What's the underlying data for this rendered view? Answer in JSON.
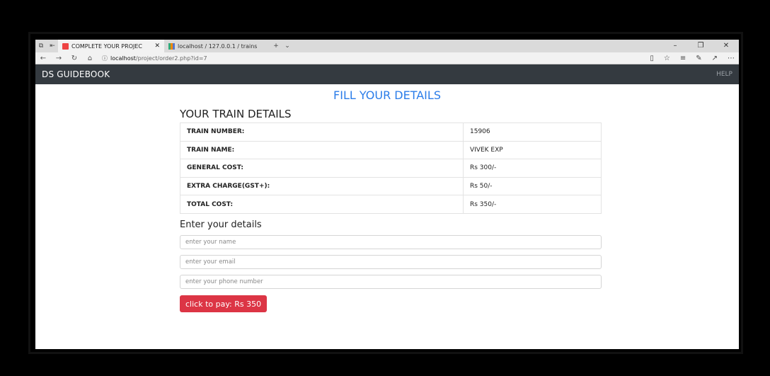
{
  "browser": {
    "tabs": [
      {
        "label": "COMPLETE YOUR PROJEC",
        "active": true
      },
      {
        "label": "localhost / 127.0.0.1 / trains",
        "active": false
      }
    ],
    "url_host": "localhost",
    "url_path": "/project/order2.php?id=7"
  },
  "navbar": {
    "brand": "DS GUIDEBOOK",
    "help": "HELP"
  },
  "main": {
    "title": "FILL YOUR DETAILS",
    "train_section_title": "YOUR TRAIN DETAILS",
    "train_details": [
      {
        "key": "TRAIN NUMBER:",
        "value": "15906"
      },
      {
        "key": "TRAIN NAME:",
        "value": "VIVEK EXP"
      },
      {
        "key": "GENERAL COST:",
        "value": "Rs 300/-"
      },
      {
        "key": "EXTRA CHARGE(GST+):",
        "value": "Rs 50/-"
      },
      {
        "key": "TOTAL COST:",
        "value": "Rs 350/-"
      }
    ],
    "form_title": "Enter your details",
    "name_placeholder": "enter your name",
    "email_placeholder": "enter your email",
    "phone_placeholder": "enter your phone number",
    "pay_button": "click to pay: Rs 350"
  },
  "colors": {
    "navbar_bg": "#343a40",
    "title_blue": "#2b7de9",
    "pay_red": "#dc3545"
  }
}
